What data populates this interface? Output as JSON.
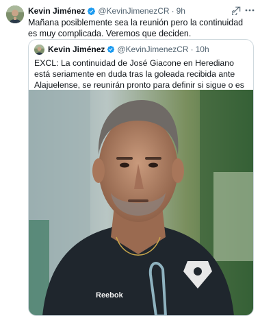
{
  "tweet": {
    "author_name": "Kevin Jiménez",
    "handle": "@KevinJimenezCR",
    "separator": "·",
    "time": "9h",
    "text": "Mañana posiblemente sea la reunión pero la continuidad es muy complicada. Veremos que deciden."
  },
  "quote": {
    "author_name": "Kevin Jiménez",
    "handle": "@KevinJimenezCR",
    "separator": "·",
    "time": "10h",
    "text": "EXCL: La continuidad de José Giacone en Herediano está seriamente en duda tras la goleada recibida ante Alajuelense, se reunirán pronto para definir si sigue o es cesado.",
    "emoji_icon": "firecracker-icon",
    "photo_brand_text": "Reebok"
  },
  "icons": {
    "verified": "verified-badge-icon",
    "grok": "grok-icon",
    "more": "more-icon"
  },
  "colors": {
    "verified_blue": "#1d9bf0",
    "text_primary": "#0f1419",
    "text_secondary": "#536471",
    "border": "#cfd9de"
  }
}
